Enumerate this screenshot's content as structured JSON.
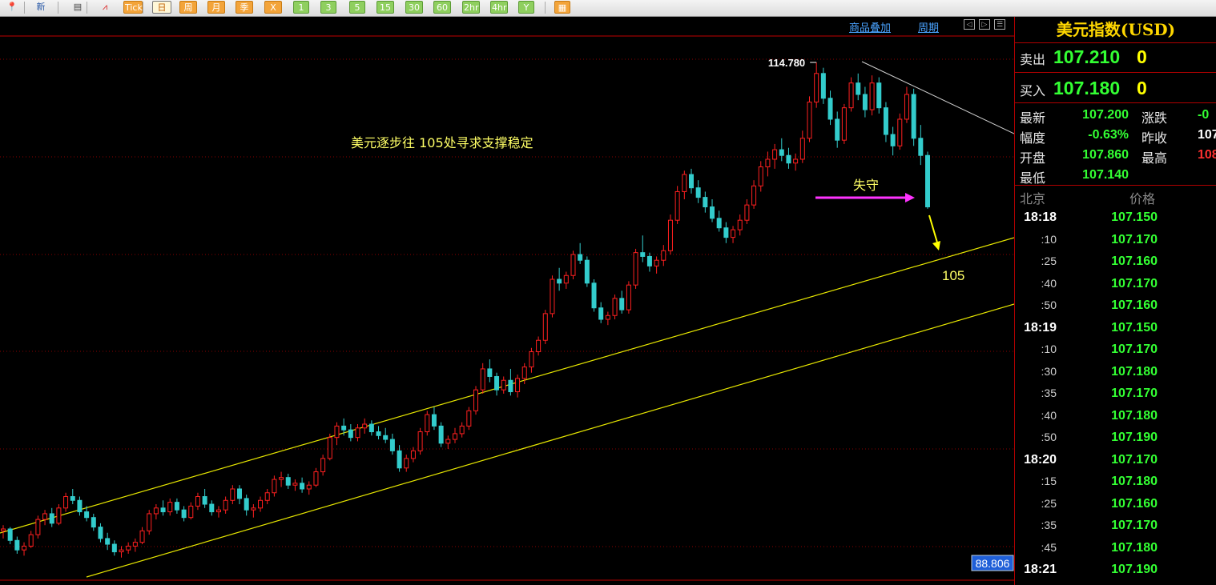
{
  "toolbar": {
    "buttons": [
      {
        "id": "b0",
        "label": "",
        "kind": "plain"
      },
      {
        "id": "b1",
        "label": "新",
        "kind": "plain"
      },
      {
        "id": "b2",
        "label": "",
        "kind": "plain"
      },
      {
        "id": "b3",
        "label": "",
        "kind": "plain"
      },
      {
        "id": "b4",
        "label": "Tick",
        "kind": "orange"
      },
      {
        "id": "b5",
        "label": "日",
        "kind": "sel"
      },
      {
        "id": "b6",
        "label": "周",
        "kind": "orange"
      },
      {
        "id": "b7",
        "label": "月",
        "kind": "orange"
      },
      {
        "id": "b8",
        "label": "季",
        "kind": "orange"
      },
      {
        "id": "b9",
        "label": "X",
        "kind": "orange"
      },
      {
        "id": "b10",
        "label": "1",
        "kind": "green"
      },
      {
        "id": "b11",
        "label": "3",
        "kind": "green"
      },
      {
        "id": "b12",
        "label": "5",
        "kind": "green"
      },
      {
        "id": "b13",
        "label": "15",
        "kind": "green"
      },
      {
        "id": "b14",
        "label": "30",
        "kind": "green"
      },
      {
        "id": "b15",
        "label": "60",
        "kind": "green"
      },
      {
        "id": "b16",
        "label": "2hr",
        "kind": "green"
      },
      {
        "id": "b17",
        "label": "4hr",
        "kind": "green"
      },
      {
        "id": "b18",
        "label": "Y",
        "kind": "green"
      },
      {
        "id": "b19",
        "label": "",
        "kind": "orange"
      }
    ]
  },
  "chart": {
    "overlay_link": "商品叠加",
    "period_link": "周期",
    "annotation_main": "美元逐步往 105处寻求支撑稳定",
    "annotation_lost": "失守",
    "annotation_support": "105",
    "high_label": "114.780",
    "axis_bottom_value": "88.806"
  },
  "chart_data": {
    "type": "candlestick",
    "title": "美元指数(USD)",
    "high": 114.78,
    "axis_bottom": 88.806,
    "support": 105,
    "candles": [
      [
        90.2,
        90.5,
        89.8,
        90.3
      ],
      [
        90.3,
        90.4,
        89.5,
        89.7
      ],
      [
        89.7,
        89.9,
        89.0,
        89.2
      ],
      [
        89.2,
        89.6,
        88.9,
        89.4
      ],
      [
        89.4,
        90.2,
        89.3,
        90.0
      ],
      [
        90.0,
        91.0,
        89.8,
        90.8
      ],
      [
        90.8,
        91.3,
        90.5,
        91.1
      ],
      [
        91.1,
        91.4,
        90.4,
        90.6
      ],
      [
        90.6,
        91.6,
        90.5,
        91.4
      ],
      [
        91.4,
        92.2,
        91.2,
        92.0
      ],
      [
        92.0,
        92.4,
        91.6,
        91.8
      ],
      [
        91.8,
        92.0,
        91.0,
        91.2
      ],
      [
        91.2,
        91.5,
        90.7,
        90.9
      ],
      [
        90.9,
        91.1,
        90.2,
        90.4
      ],
      [
        90.4,
        90.6,
        89.6,
        89.8
      ],
      [
        89.8,
        90.1,
        89.2,
        89.5
      ],
      [
        89.5,
        89.7,
        88.9,
        89.1
      ],
      [
        89.1,
        89.4,
        88.8,
        89.2
      ],
      [
        89.2,
        89.6,
        89.0,
        89.4
      ],
      [
        89.4,
        89.8,
        89.1,
        89.6
      ],
      [
        89.6,
        90.4,
        89.5,
        90.2
      ],
      [
        90.2,
        91.3,
        90.0,
        91.1
      ],
      [
        91.1,
        91.6,
        90.8,
        91.4
      ],
      [
        91.4,
        91.8,
        91.0,
        91.2
      ],
      [
        91.2,
        91.9,
        91.0,
        91.7
      ],
      [
        91.7,
        91.9,
        91.1,
        91.3
      ],
      [
        91.3,
        91.5,
        90.7,
        90.9
      ],
      [
        90.9,
        91.7,
        90.8,
        91.5
      ],
      [
        91.5,
        92.2,
        91.3,
        92.0
      ],
      [
        92.0,
        92.4,
        91.4,
        91.6
      ],
      [
        91.6,
        91.8,
        91.0,
        91.2
      ],
      [
        91.2,
        91.5,
        90.9,
        91.3
      ],
      [
        91.3,
        92.0,
        91.1,
        91.8
      ],
      [
        91.8,
        92.6,
        91.6,
        92.4
      ],
      [
        92.4,
        92.6,
        91.6,
        91.9
      ],
      [
        91.9,
        92.1,
        91.0,
        91.3
      ],
      [
        91.3,
        91.6,
        90.9,
        91.4
      ],
      [
        91.4,
        92.0,
        91.2,
        91.8
      ],
      [
        91.8,
        92.4,
        91.6,
        92.2
      ],
      [
        92.2,
        93.1,
        92.0,
        92.9
      ],
      [
        92.9,
        93.3,
        92.5,
        93.0
      ],
      [
        93.0,
        93.2,
        92.4,
        92.6
      ],
      [
        92.6,
        92.9,
        92.3,
        92.7
      ],
      [
        92.7,
        93.0,
        92.2,
        92.4
      ],
      [
        92.4,
        92.8,
        92.1,
        92.6
      ],
      [
        92.6,
        93.5,
        92.5,
        93.3
      ],
      [
        93.3,
        94.2,
        93.1,
        94.0
      ],
      [
        94.0,
        95.3,
        93.9,
        95.1
      ],
      [
        95.1,
        95.9,
        94.7,
        95.7
      ],
      [
        95.7,
        96.1,
        95.2,
        95.5
      ],
      [
        95.5,
        95.8,
        94.9,
        95.1
      ],
      [
        95.1,
        95.8,
        94.9,
        95.6
      ],
      [
        95.6,
        96.1,
        95.3,
        95.8
      ],
      [
        95.8,
        96.0,
        95.2,
        95.4
      ],
      [
        95.4,
        95.7,
        95.0,
        95.2
      ],
      [
        95.2,
        95.6,
        94.8,
        95.0
      ],
      [
        95.0,
        95.3,
        94.2,
        94.4
      ],
      [
        94.4,
        94.7,
        93.3,
        93.5
      ],
      [
        93.5,
        94.2,
        93.3,
        94.0
      ],
      [
        94.0,
        94.6,
        93.8,
        94.4
      ],
      [
        94.4,
        95.6,
        94.2,
        95.4
      ],
      [
        95.4,
        96.5,
        95.2,
        96.3
      ],
      [
        96.3,
        96.7,
        95.5,
        95.7
      ],
      [
        95.7,
        95.9,
        94.6,
        94.8
      ],
      [
        94.8,
        95.2,
        94.5,
        95.0
      ],
      [
        95.0,
        95.6,
        94.8,
        95.3
      ],
      [
        95.3,
        95.9,
        95.1,
        95.7
      ],
      [
        95.7,
        96.7,
        95.5,
        96.5
      ],
      [
        96.5,
        97.8,
        96.3,
        97.6
      ],
      [
        97.6,
        99.0,
        97.4,
        98.7
      ],
      [
        98.7,
        99.2,
        98.0,
        98.3
      ],
      [
        98.3,
        98.5,
        97.3,
        97.6
      ],
      [
        97.6,
        98.3,
        97.4,
        98.1
      ],
      [
        98.1,
        98.7,
        97.3,
        97.5
      ],
      [
        97.5,
        98.4,
        97.2,
        98.2
      ],
      [
        98.2,
        99.0,
        97.9,
        98.8
      ],
      [
        98.8,
        99.8,
        98.5,
        99.6
      ],
      [
        99.6,
        100.4,
        99.4,
        100.2
      ],
      [
        100.2,
        101.8,
        100.0,
        101.6
      ],
      [
        101.6,
        103.6,
        101.4,
        103.4
      ],
      [
        103.4,
        104.0,
        102.8,
        103.2
      ],
      [
        103.2,
        103.8,
        102.9,
        103.6
      ],
      [
        103.6,
        104.9,
        103.4,
        104.7
      ],
      [
        104.7,
        105.3,
        104.2,
        104.4
      ],
      [
        104.4,
        104.6,
        103.0,
        103.2
      ],
      [
        103.2,
        103.4,
        101.7,
        101.9
      ],
      [
        101.9,
        102.2,
        101.1,
        101.3
      ],
      [
        101.3,
        101.7,
        101.0,
        101.5
      ],
      [
        101.5,
        102.6,
        101.3,
        102.4
      ],
      [
        102.4,
        102.8,
        101.6,
        101.8
      ],
      [
        101.8,
        103.3,
        101.6,
        103.1
      ],
      [
        103.1,
        105.0,
        102.9,
        104.8
      ],
      [
        104.8,
        105.7,
        104.3,
        104.6
      ],
      [
        104.6,
        104.8,
        103.8,
        104.1
      ],
      [
        104.1,
        104.6,
        103.7,
        104.4
      ],
      [
        104.4,
        105.2,
        104.1,
        104.9
      ],
      [
        104.9,
        106.8,
        104.7,
        106.5
      ],
      [
        106.5,
        108.3,
        106.3,
        108.0
      ],
      [
        108.0,
        109.1,
        107.6,
        108.9
      ],
      [
        108.9,
        109.2,
        107.9,
        108.2
      ],
      [
        108.2,
        108.6,
        107.4,
        107.7
      ],
      [
        107.7,
        108.0,
        106.9,
        107.2
      ],
      [
        107.2,
        107.6,
        106.4,
        106.6
      ],
      [
        106.6,
        107.0,
        105.9,
        106.1
      ],
      [
        106.1,
        106.4,
        105.3,
        105.6
      ],
      [
        105.6,
        106.2,
        105.3,
        106.0
      ],
      [
        106.0,
        106.8,
        105.7,
        106.5
      ],
      [
        106.5,
        107.6,
        106.3,
        107.3
      ],
      [
        107.3,
        108.6,
        107.1,
        108.3
      ],
      [
        108.3,
        109.6,
        108.0,
        109.3
      ],
      [
        109.3,
        110.1,
        108.8,
        109.7
      ],
      [
        109.7,
        110.5,
        109.2,
        110.2
      ],
      [
        110.2,
        110.8,
        109.6,
        109.9
      ],
      [
        109.9,
        110.3,
        109.2,
        109.5
      ],
      [
        109.5,
        110.0,
        109.1,
        109.7
      ],
      [
        109.7,
        111.2,
        109.5,
        110.8
      ],
      [
        110.8,
        113.0,
        110.6,
        112.7
      ],
      [
        112.7,
        114.78,
        112.4,
        114.2
      ],
      [
        114.2,
        114.5,
        112.6,
        112.9
      ],
      [
        112.9,
        113.3,
        111.5,
        111.8
      ],
      [
        111.8,
        112.2,
        110.3,
        110.7
      ],
      [
        110.7,
        112.6,
        110.5,
        112.4
      ],
      [
        112.4,
        114.0,
        112.2,
        113.7
      ],
      [
        113.7,
        114.2,
        112.8,
        113.1
      ],
      [
        113.1,
        113.5,
        111.9,
        112.3
      ],
      [
        112.3,
        114.1,
        112.0,
        113.7
      ],
      [
        113.7,
        114.0,
        112.1,
        112.4
      ],
      [
        112.4,
        112.7,
        110.6,
        111.0
      ],
      [
        111.0,
        111.4,
        109.9,
        110.4
      ],
      [
        110.4,
        112.1,
        110.2,
        111.8
      ],
      [
        111.8,
        113.5,
        111.6,
        113.1
      ],
      [
        113.1,
        113.4,
        110.4,
        110.8
      ],
      [
        110.8,
        111.5,
        109.4,
        109.9
      ],
      [
        109.9,
        110.1,
        107.1,
        107.2
      ]
    ]
  },
  "panel": {
    "title": "美元指数(USD)",
    "sell_label": "卖出",
    "sell_price": "107.210",
    "sell_qty": "0",
    "buy_label": "买入",
    "buy_price": "107.180",
    "buy_qty": "0",
    "stats": [
      {
        "label": "最新",
        "value": "107.200",
        "color": "green",
        "label2": "涨跌",
        "value2": "-0",
        "color2": "green"
      },
      {
        "label": "幅度",
        "value": "-0.63%",
        "color": "green",
        "label2": "昨收",
        "value2": "107",
        "color2": "white"
      },
      {
        "label": "开盘",
        "value": "107.860",
        "color": "green",
        "label2": "最高",
        "value2": "108",
        "color2": "red"
      },
      {
        "label": "最低",
        "value": "107.140",
        "color": "green",
        "label2": "",
        "value2": "",
        "color2": "white"
      }
    ],
    "tick_header_time": "北京",
    "tick_header_price": "价格",
    "ticks": [
      {
        "time": "18:18",
        "price": "107.150",
        "hour": true
      },
      {
        "time": ":10",
        "price": "107.170",
        "hour": false
      },
      {
        "time": ":25",
        "price": "107.160",
        "hour": false
      },
      {
        "time": ":40",
        "price": "107.170",
        "hour": false
      },
      {
        "time": ":50",
        "price": "107.160",
        "hour": false
      },
      {
        "time": "18:19",
        "price": "107.150",
        "hour": true
      },
      {
        "time": ":10",
        "price": "107.170",
        "hour": false
      },
      {
        "time": ":30",
        "price": "107.180",
        "hour": false
      },
      {
        "time": ":35",
        "price": "107.170",
        "hour": false
      },
      {
        "time": ":40",
        "price": "107.180",
        "hour": false
      },
      {
        "time": ":50",
        "price": "107.190",
        "hour": false
      },
      {
        "time": "18:20",
        "price": "107.170",
        "hour": true
      },
      {
        "time": ":15",
        "price": "107.180",
        "hour": false
      },
      {
        "time": ":25",
        "price": "107.160",
        "hour": false
      },
      {
        "time": ":35",
        "price": "107.170",
        "hour": false
      },
      {
        "time": ":45",
        "price": "107.180",
        "hour": false
      },
      {
        "time": "18:21",
        "price": "107.190",
        "hour": true
      }
    ]
  }
}
